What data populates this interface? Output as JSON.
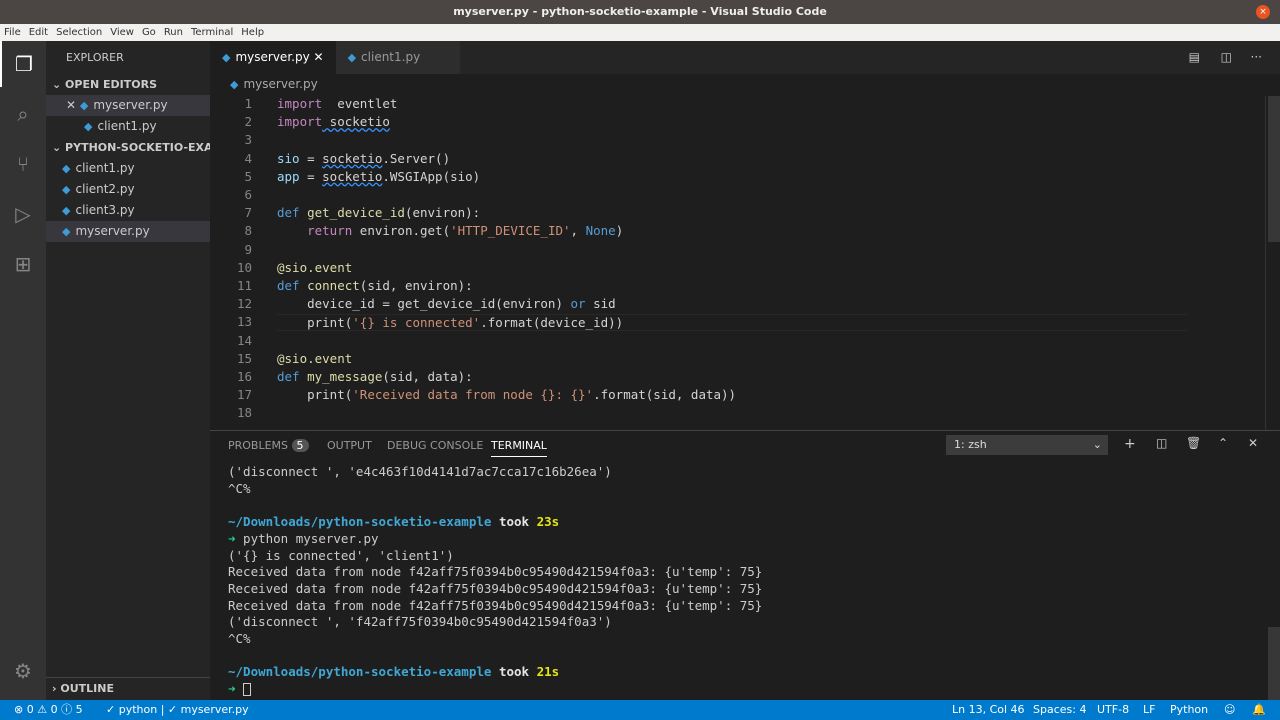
{
  "window": {
    "title": "myserver.py - python-socketio-example - Visual Studio Code",
    "close": "×"
  },
  "menu": [
    "File",
    "Edit",
    "Selection",
    "View",
    "Go",
    "Run",
    "Terminal",
    "Help"
  ],
  "sidebar": {
    "title": "EXPLORER",
    "open_editors": "OPEN EDITORS",
    "open_files": [
      "myserver.py",
      "client1.py"
    ],
    "folder": "PYTHON-SOCKETIO-EXA...",
    "files": [
      "client1.py",
      "client2.py",
      "client3.py",
      "myserver.py"
    ],
    "outline": "OUTLINE"
  },
  "tabs": [
    "myserver.py",
    "client1.py"
  ],
  "breadcrumb": "myserver.py",
  "code": [
    [
      [
        "kw",
        "import"
      ],
      [
        "",
        "  eventlet"
      ]
    ],
    [
      [
        "kw",
        "import"
      ],
      [
        "",
        ""
      ],
      [
        "sq",
        " socketio"
      ]
    ],
    [],
    [
      [
        "vr",
        "sio"
      ],
      [
        "",
        " = "
      ],
      [
        "sq",
        "socketio"
      ],
      [
        "",
        ".Server()"
      ]
    ],
    [
      [
        "vr",
        "app"
      ],
      [
        "",
        " = "
      ],
      [
        "sq",
        "socketio"
      ],
      [
        "",
        ".WSGIApp(sio)"
      ]
    ],
    [],
    [
      [
        "df",
        "def"
      ],
      [
        "",
        " "
      ],
      [
        "fn",
        "get_device_id"
      ],
      [
        "",
        "(environ):"
      ]
    ],
    [
      [
        "",
        "    "
      ],
      [
        "kw",
        "return"
      ],
      [
        "",
        " environ.get("
      ],
      [
        "st",
        "'HTTP_DEVICE_ID'"
      ],
      [
        "",
        ", "
      ],
      [
        "df",
        "None"
      ],
      [
        "",
        ")"
      ]
    ],
    [],
    [
      [
        "fn",
        "@sio.event"
      ]
    ],
    [
      [
        "df",
        "def"
      ],
      [
        "",
        " "
      ],
      [
        "fn",
        "connect"
      ],
      [
        "",
        "(sid, environ):"
      ]
    ],
    [
      [
        "",
        "    device_id = get_device_id(environ) "
      ],
      [
        "df",
        "or"
      ],
      [
        "",
        " sid"
      ]
    ],
    [
      [
        "",
        "    print("
      ],
      [
        "st",
        "'{} is connected'"
      ],
      [
        "",
        ".format(device_id))"
      ]
    ],
    [],
    [
      [
        "fn",
        "@sio.event"
      ]
    ],
    [
      [
        "df",
        "def"
      ],
      [
        "",
        " "
      ],
      [
        "fn",
        "my_message"
      ],
      [
        "",
        "(sid, data):"
      ]
    ],
    [
      [
        "",
        "    print("
      ],
      [
        "st",
        "'Received data from node {}: {}'"
      ],
      [
        "",
        ".format(sid, data))"
      ]
    ],
    []
  ],
  "panel": {
    "tabs": [
      "PROBLEMS",
      "OUTPUT",
      "DEBUG CONSOLE",
      "TERMINAL"
    ],
    "problems_count": "5",
    "terminal_select": "1: zsh"
  },
  "terminal": [
    "('disconnect ', 'e4c463f10d4141d7ac7cca17c16b26ea')",
    "^C%",
    "",
    "~/Downloads/python-socketio-example|took |23s",
    "➜ python myserver.py",
    "('{} is connected', 'client1')",
    "Received data from node f42aff75f0394b0c95490d421594f0a3: {u'temp': 75}",
    "Received data from node f42aff75f0394b0c95490d421594f0a3: {u'temp': 75}",
    "Received data from node f42aff75f0394b0c95490d421594f0a3: {u'temp': 75}",
    "('disconnect ', 'f42aff75f0394b0c95490d421594f0a3')",
    "^C%",
    "",
    "~/Downloads/python-socketio-example|took |21s",
    "➜ "
  ],
  "status": {
    "errors": "0",
    "warnings": "0",
    "info": "5",
    "python": "✓ python | ✓ myserver.py",
    "position": "Ln 13, Col 46",
    "spaces": "Spaces: 4",
    "encoding": "UTF-8",
    "eol": "LF",
    "language": "Python"
  }
}
